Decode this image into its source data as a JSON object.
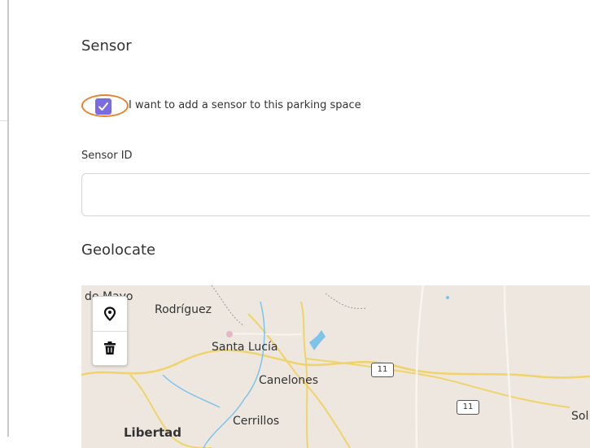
{
  "sensor_section": {
    "title": "Sensor",
    "checkbox_label": "I want to add a sensor to this parking space",
    "checkbox_checked": true,
    "sensor_id_label": "Sensor ID",
    "sensor_id_value": ""
  },
  "geolocate_section": {
    "title": "Geolocate",
    "map": {
      "places": [
        "de Mayo",
        "Rodríguez",
        "Santa Lucía",
        "Canelones",
        "Cerrillos",
        "Libertad",
        "Sol"
      ],
      "route_shields": [
        "11",
        "11"
      ],
      "tools": [
        "marker-tool",
        "delete-tool"
      ]
    }
  },
  "colors": {
    "checkbox": "#7a6be0",
    "highlight_ring": "#e5832e",
    "map_background": "#ede7df",
    "road": "#f0d36a",
    "water": "#7ec4ea"
  }
}
